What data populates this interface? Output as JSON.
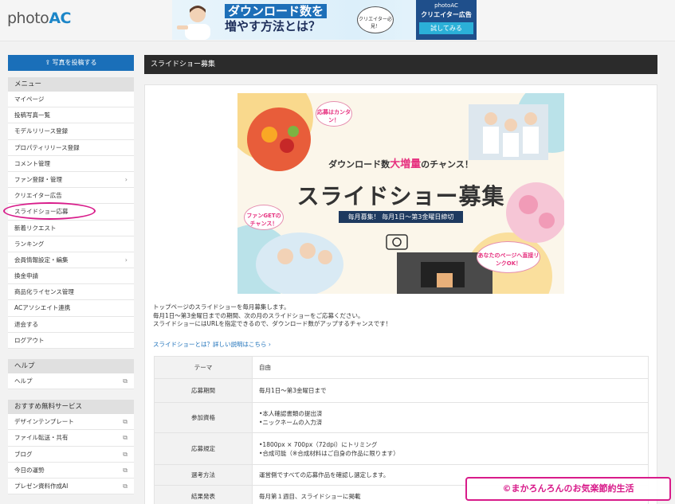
{
  "logo": {
    "text": "photo",
    "accent": "AC"
  },
  "banner": {
    "line1": "ダウンロード数を",
    "line2": "増やす方法とは？",
    "badge": "クリエイター必見！",
    "brand": "photoAC",
    "product": "クリエイター広告",
    "cta": "試してみる"
  },
  "sidebar": {
    "upload_button": "写真を投稿する",
    "menu_title": "メニュー",
    "menu_items": [
      {
        "label": "マイページ",
        "arrow": false
      },
      {
        "label": "投稿写真一覧",
        "arrow": false
      },
      {
        "label": "モデルリリース登録",
        "arrow": false
      },
      {
        "label": "プロパティリリース登録",
        "arrow": false
      },
      {
        "label": "コメント管理",
        "arrow": false
      },
      {
        "label": "ファン登録・管理",
        "arrow": true
      },
      {
        "label": "クリエイター広告",
        "arrow": false
      },
      {
        "label": "スライドショー応募",
        "arrow": false
      },
      {
        "label": "新着リクエスト",
        "arrow": false
      },
      {
        "label": "ランキング",
        "arrow": false
      },
      {
        "label": "会員情報設定・編集",
        "arrow": true
      },
      {
        "label": "換金申請",
        "arrow": false
      },
      {
        "label": "商品化ライセンス管理",
        "arrow": false
      },
      {
        "label": "ACアソシエイト連携",
        "arrow": false
      },
      {
        "label": "退会する",
        "arrow": false
      },
      {
        "label": "ログアウト",
        "arrow": false
      }
    ],
    "help_title": "ヘルプ",
    "help_items": [
      {
        "label": "ヘルプ"
      }
    ],
    "services_title": "おすすめ無料サービス",
    "service_items": [
      {
        "label": "デザインテンプレート"
      },
      {
        "label": "ファイル転送・共有"
      },
      {
        "label": "ブログ"
      },
      {
        "label": "今日の運勢"
      },
      {
        "label": "プレゼン資料作成AI"
      }
    ]
  },
  "main": {
    "title": "スライドショー募集",
    "hero": {
      "sub_prefix": "ダウンロード数",
      "sub_pink": "大増量",
      "sub_suffix": "のチャンス！",
      "title": "スライドショー募集",
      "monthly": "毎月募集！ 毎月1日～第3金曜日締切",
      "bubble1": "応募はカンタン！",
      "bubble2": "ファンGETのチャンス！",
      "bubble3": "あなたのページへ直接リンクOK！"
    },
    "desc_lines": [
      "トップページのスライドショーを毎月募集します。",
      "毎月1日～第3金曜日までの期間、次の月のスライドショーをご応募ください。",
      "スライドショーにはURLを指定できるので、ダウンロード数がアップするチャンスです！"
    ],
    "link": "スライドショーとは？詳しい説明はこちら ›",
    "table": [
      {
        "key": "テーマ",
        "value": [
          "自由"
        ]
      },
      {
        "key": "応募期間",
        "value": [
          "毎月1日～第3金曜日まで"
        ]
      },
      {
        "key": "参加資格",
        "value": [
          "•本人確認書類の提出済",
          "•ニックネームの入力済"
        ]
      },
      {
        "key": "応募規定",
        "value": [
          "•1800px × 700px（72dpi）にトリミング",
          "•合成可能（※合成材料はご自身の作品に限ります）"
        ]
      },
      {
        "key": "選考方法",
        "value": [
          "運営側ですべての応募作品を確認し選定します。"
        ]
      },
      {
        "key": "結果発表",
        "value": [
          "毎月第１週目、スライドショーに掲載"
        ]
      }
    ]
  },
  "watermark": "©まかろんろんのお気楽節約生活"
}
